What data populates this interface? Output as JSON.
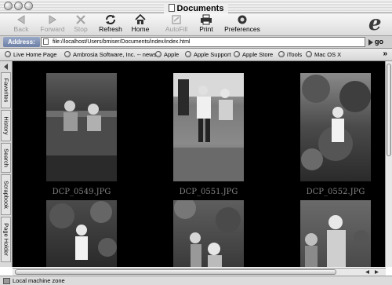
{
  "window": {
    "title": "Documents"
  },
  "toolbar": {
    "buttons": [
      {
        "label": "Back",
        "icon": "back-arrow-icon",
        "enabled": false
      },
      {
        "label": "Forward",
        "icon": "forward-arrow-icon",
        "enabled": false
      },
      {
        "label": "Stop",
        "icon": "stop-icon",
        "enabled": false
      },
      {
        "label": "Refresh",
        "icon": "refresh-icon",
        "enabled": true
      },
      {
        "label": "Home",
        "icon": "home-icon",
        "enabled": true
      },
      {
        "label": "AutoFill",
        "icon": "autofill-icon",
        "enabled": false
      },
      {
        "label": "Print",
        "icon": "print-icon",
        "enabled": true
      },
      {
        "label": "Preferences",
        "icon": "preferences-icon",
        "enabled": true
      }
    ]
  },
  "address": {
    "label": "Address:",
    "value": "file://localhost/Users/bmiser/Documents/index/index.html",
    "go_label": "go"
  },
  "favorites": [
    "Live Home Page",
    "Ambrosia Software, Inc. -- news",
    "Apple",
    "Apple Support",
    "Apple Store",
    "iTools",
    "Mac OS X"
  ],
  "sidebar_tabs": [
    "Favorites",
    "History",
    "Search",
    "Scrapbook",
    "Page Holder"
  ],
  "gallery": {
    "images": [
      {
        "caption": "DCP_0549.JPG"
      },
      {
        "caption": "DCP_0551.JPG"
      },
      {
        "caption": "DCP_0552.JPG"
      },
      {
        "caption": ""
      },
      {
        "caption": ""
      },
      {
        "caption": ""
      }
    ]
  },
  "status": {
    "text": "Local machine zone"
  }
}
